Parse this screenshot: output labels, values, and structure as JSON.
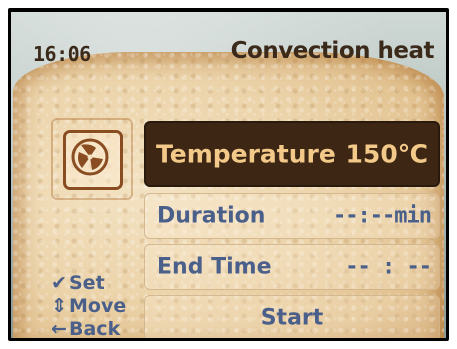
{
  "header": {
    "time": "16:06",
    "mode": "Convection heat"
  },
  "menu": {
    "temperature": {
      "label": "Temperature",
      "value": "150℃"
    },
    "duration": {
      "label": "Duration",
      "value": "--:--min"
    },
    "end_time": {
      "label": "End Time",
      "value": "-- : --"
    },
    "start": {
      "label": "Start"
    }
  },
  "legend": {
    "set": {
      "icon": "check-icon",
      "glyph": "✔",
      "label": "Set"
    },
    "move": {
      "icon": "updown-arrow-icon",
      "glyph": "⇕",
      "label": "Move"
    },
    "back": {
      "icon": "left-arrow-icon",
      "glyph": "←",
      "label": "Back"
    }
  },
  "colors": {
    "selected_bg": "#3d2714",
    "selected_text": "#f3c98a",
    "text_blue": "#4a5f8a",
    "header_text": "#3b2a1a"
  }
}
